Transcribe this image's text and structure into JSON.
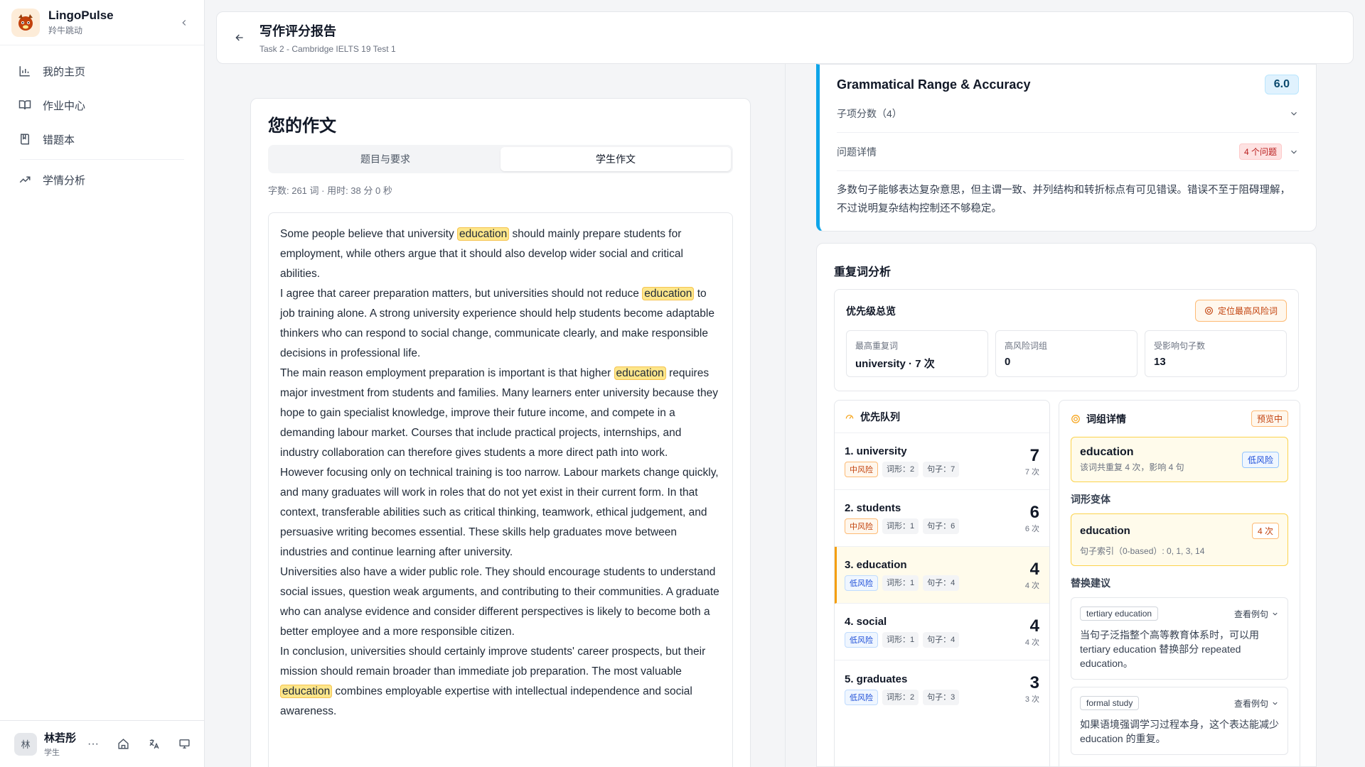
{
  "app": {
    "name": "LingoPulse",
    "subtitle": "羚牛跳动"
  },
  "nav": [
    {
      "label": "我的主页",
      "icon": "bar-chart-icon"
    },
    {
      "label": "作业中心",
      "icon": "book-open-icon"
    },
    {
      "label": "错题本",
      "icon": "bookmark-book-icon"
    },
    {
      "label": "学情分析",
      "icon": "trending-up-icon"
    }
  ],
  "user": {
    "initial": "林",
    "name": "林若彤",
    "role": "学生"
  },
  "header": {
    "title": "写作评分报告",
    "subtitle": "Task 2 - Cambridge IELTS 19 Test 1"
  },
  "essay": {
    "title": "您的作文",
    "tabs": [
      "题目与要求",
      "学生作文"
    ],
    "active_tab": 1,
    "meta": "字数: 261 词 · 用时: 38 分 0 秒",
    "paragraphs": [
      {
        "pre": "Some people believe that university ",
        "hl": "education",
        "post": " should mainly prepare students for employment, while others argue that it should also develop wider social and critical abilities."
      },
      {
        "pre": "I agree that career preparation matters, but universities should not reduce ",
        "hl": "education",
        "post": " to job training alone. A strong university experience should help students become adaptable thinkers who can respond to social change, communicate clearly, and make responsible decisions in professional life."
      },
      {
        "pre": "The main reason employment preparation is important is that higher ",
        "hl": "education",
        "post": " requires major investment from students and families. Many learners enter university because they hope to gain specialist knowledge, improve their future income, and compete in a demanding labour market. Courses that include practical projects, internships, and industry collaboration can therefore gives students a more direct path into work."
      },
      {
        "pre": "However focusing only on technical training is too narrow. Labour markets change quickly, and many graduates will work in roles that do not yet exist in their current form. In that context, transferable abilities such as critical thinking, teamwork, ethical judgement, and persuasive writing becomes essential. These skills help graduates move between industries and continue learning after university.",
        "hl": "",
        "post": ""
      },
      {
        "pre": "Universities also have a wider public role. They should encourage students to understand social issues, question weak arguments, and contributing to their communities. A graduate who can analyse evidence and consider different perspectives is likely to become both a better employee and a more responsible citizen.",
        "hl": "",
        "post": ""
      },
      {
        "pre": "In conclusion, universities should certainly improve students' career prospects, but their mission should remain broader than immediate job preparation. The most valuable ",
        "hl": "education",
        "post": " combines employable expertise with intellectual independence and social awareness."
      }
    ]
  },
  "grammar": {
    "title": "Grammatical Range & Accuracy",
    "score": "6.0",
    "sub_scores_label": "子项分数（4）",
    "issues_label": "问题详情",
    "issues_badge": "4 个问题",
    "text": "多数句子能够表达复杂意思，但主谓一致、并列结构和转折标点有可见错误。错误不至于阻碍理解，不过说明复杂结构控制还不够稳定。"
  },
  "repetition": {
    "title": "重复词分析",
    "overview_title": "优先级总览",
    "locate_button": "定位最高风险词",
    "stats": [
      {
        "label": "最高重复词",
        "value": "university · 7 次"
      },
      {
        "label": "高风险词组",
        "value": "0"
      },
      {
        "label": "受影响句子数",
        "value": "13"
      }
    ],
    "queue_title": "优先队列",
    "queue": [
      {
        "word": "1. university",
        "risk": "中风险",
        "level": "mid",
        "forms": "词形：2",
        "sentences": "句子：7",
        "count": "7",
        "times": "7 次"
      },
      {
        "word": "2. students",
        "risk": "中风险",
        "level": "mid",
        "forms": "词形：1",
        "sentences": "句子：6",
        "count": "6",
        "times": "6 次"
      },
      {
        "word": "3. education",
        "risk": "低风险",
        "level": "low",
        "forms": "词形：1",
        "sentences": "句子：4",
        "count": "4",
        "times": "4 次"
      },
      {
        "word": "4. social",
        "risk": "低风险",
        "level": "low",
        "forms": "词形：1",
        "sentences": "句子：4",
        "count": "4",
        "times": "4 次"
      },
      {
        "word": "5. graduates",
        "risk": "低风险",
        "level": "low",
        "forms": "词形：2",
        "sentences": "句子：3",
        "count": "3",
        "times": "3 次"
      }
    ],
    "detail": {
      "title": "词组详情",
      "badge": "预览中",
      "word": "education",
      "word_sub": "该词共重复 4 次，影响 4 句",
      "risk": "低风险",
      "variants_label": "词形变体",
      "variant_word": "education",
      "variant_count": "4 次",
      "variant_index": "句子索引（0-based）: 0, 1, 3, 14",
      "suggest_label": "替换建议",
      "suggestions": [
        {
          "term": "tertiary education",
          "button": "查看例句",
          "text": "当句子泛指整个高等教育体系时，可以用 tertiary education 替换部分 repeated education。"
        },
        {
          "term": "formal study",
          "button": "查看例句",
          "text": "如果语境强调学习过程本身，这个表达能减少 education 的重复。"
        }
      ]
    }
  }
}
